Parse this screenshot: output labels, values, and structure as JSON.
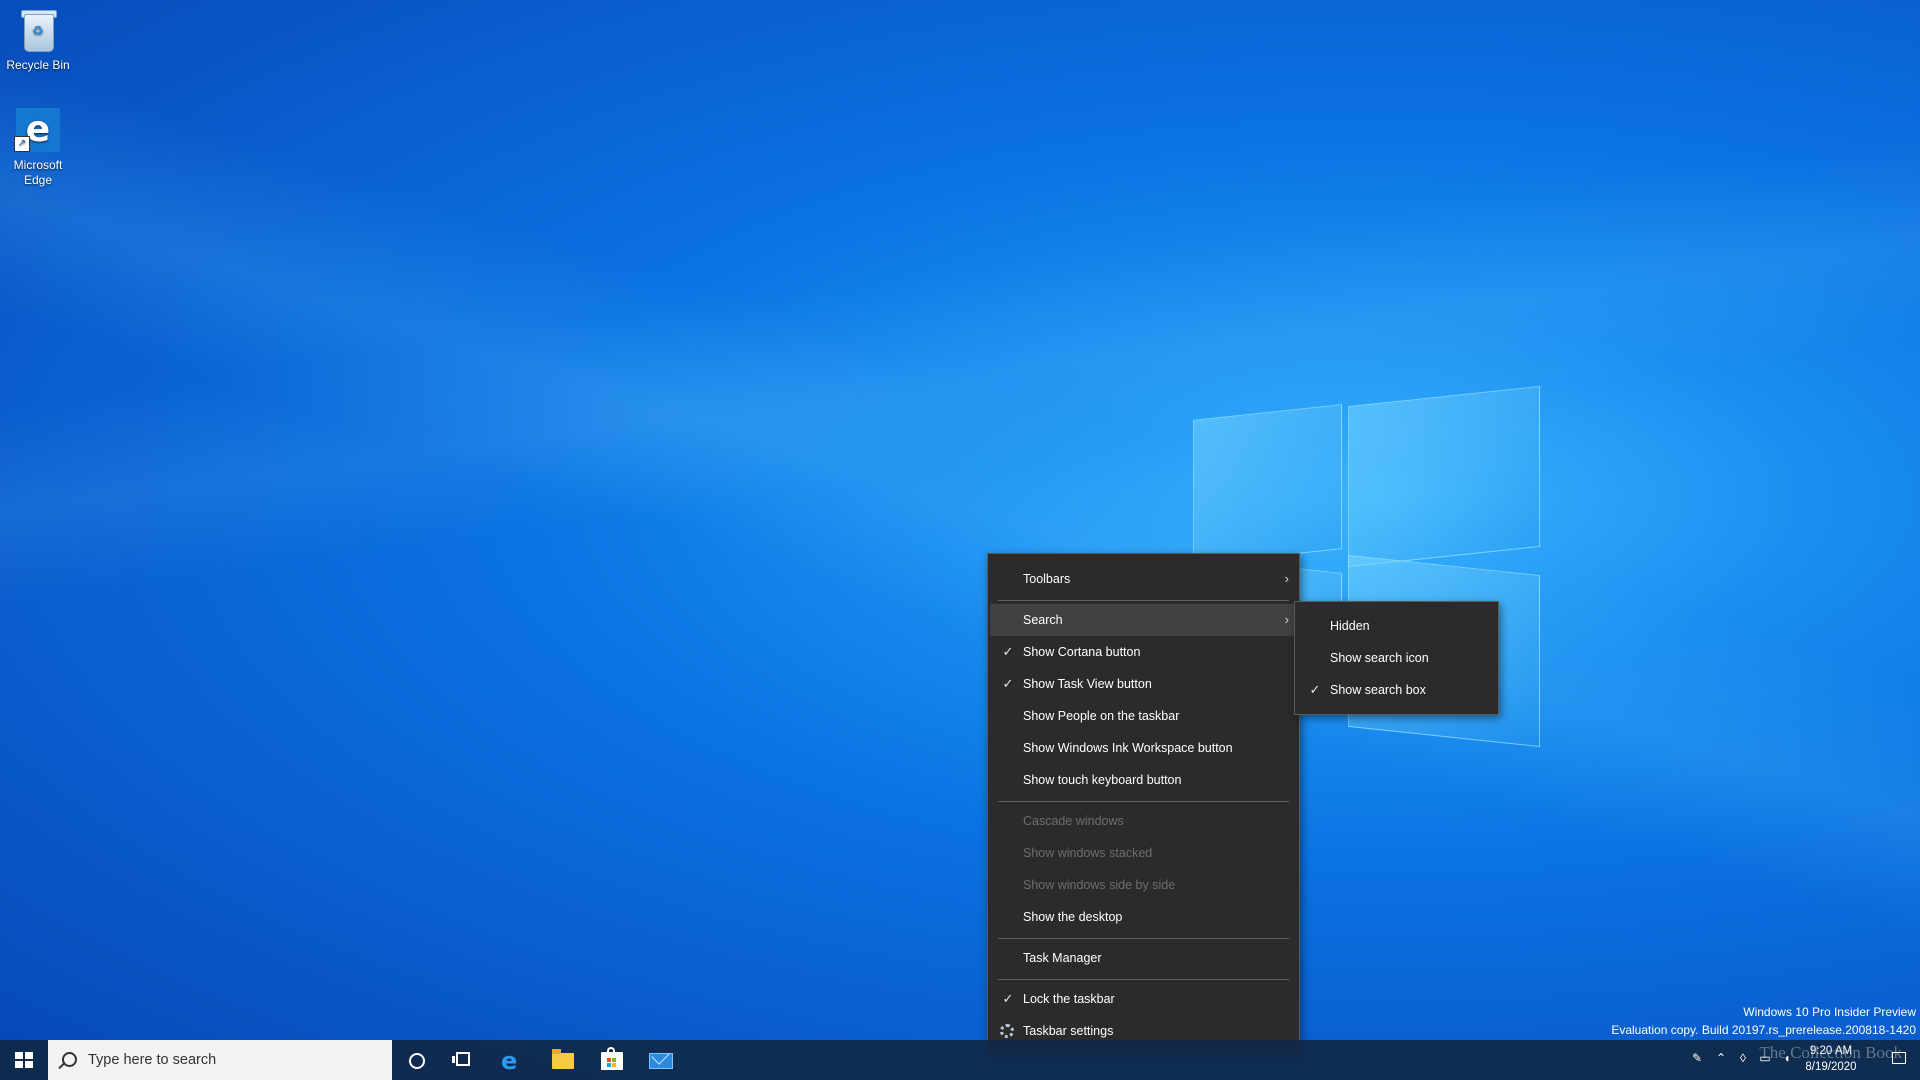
{
  "desktop": {
    "icons": [
      {
        "label": "Recycle Bin"
      },
      {
        "label": "Microsoft Edge"
      }
    ]
  },
  "context_menu": {
    "items": [
      {
        "label": "Toolbars",
        "has_submenu": true
      },
      {
        "label": "Search",
        "has_submenu": true,
        "highlighted": true
      },
      {
        "label": "Show Cortana button",
        "checked": true
      },
      {
        "label": "Show Task View button",
        "checked": true
      },
      {
        "label": "Show People on the taskbar"
      },
      {
        "label": "Show Windows Ink Workspace button"
      },
      {
        "label": "Show touch keyboard button"
      },
      {
        "label": "Cascade windows",
        "disabled": true
      },
      {
        "label": "Show windows stacked",
        "disabled": true
      },
      {
        "label": "Show windows side by side",
        "disabled": true
      },
      {
        "label": "Show the desktop"
      },
      {
        "label": "Task Manager"
      },
      {
        "label": "Lock the taskbar",
        "checked": true
      },
      {
        "label": "Taskbar settings",
        "icon": "gear-icon"
      }
    ],
    "submenu": {
      "parent": "Search",
      "items": [
        {
          "label": "Hidden"
        },
        {
          "label": "Show search icon"
        },
        {
          "label": "Show search box",
          "checked": true
        }
      ]
    }
  },
  "taskbar": {
    "search_placeholder": "Type here to search",
    "pinned": [
      "edge-icon",
      "file-explorer-icon",
      "store-icon",
      "mail-icon"
    ],
    "clock": {
      "time": "9:20 AM",
      "date": "8/19/2020"
    }
  },
  "watermark": {
    "line1": "Windows 10 Pro Insider Preview",
    "line2": "Evaluation copy. Build 20197.rs_prerelease.200818-1420",
    "brand": "The Collection Book"
  },
  "glyphs": {
    "check": "✓",
    "arrow": "›",
    "recycle": "♻",
    "edge": "e",
    "shortcut": "↗"
  }
}
